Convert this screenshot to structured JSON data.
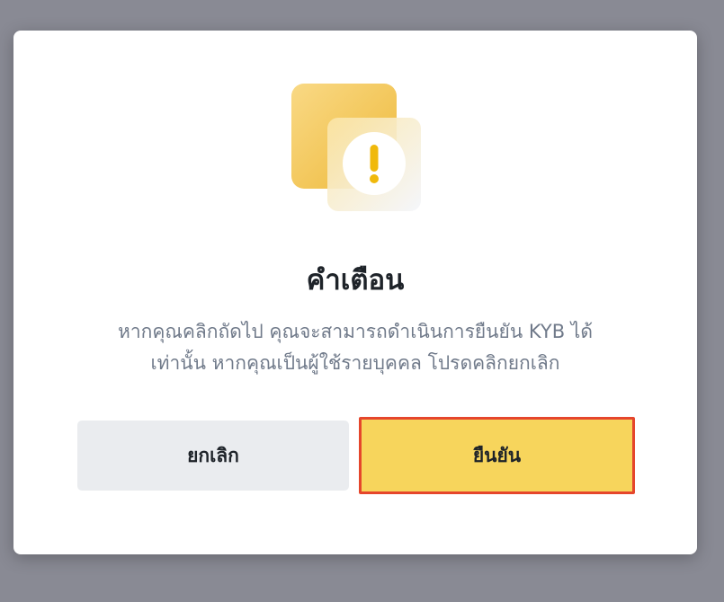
{
  "dialog": {
    "title": "คำเตือน",
    "message_line1": "หากคุณคลิกถัดไป คุณจะสามารถดำเนินการยืนยัน KYB ได้",
    "message_line2": "เท่านั้น หากคุณเป็นผู้ใช้รายบุคคล โปรดคลิกยกเลิก",
    "icon": "warning-exclamation-icon",
    "cancel_label": "ยกเลิก",
    "confirm_label": "ยืนยัน"
  },
  "colors": {
    "overlay": "#898a94",
    "accent_yellow": "#f7d55c",
    "highlight_border": "#e5462c",
    "cancel_bg": "#eaecef",
    "title_text": "#1e2329",
    "body_text": "#707a8a"
  }
}
